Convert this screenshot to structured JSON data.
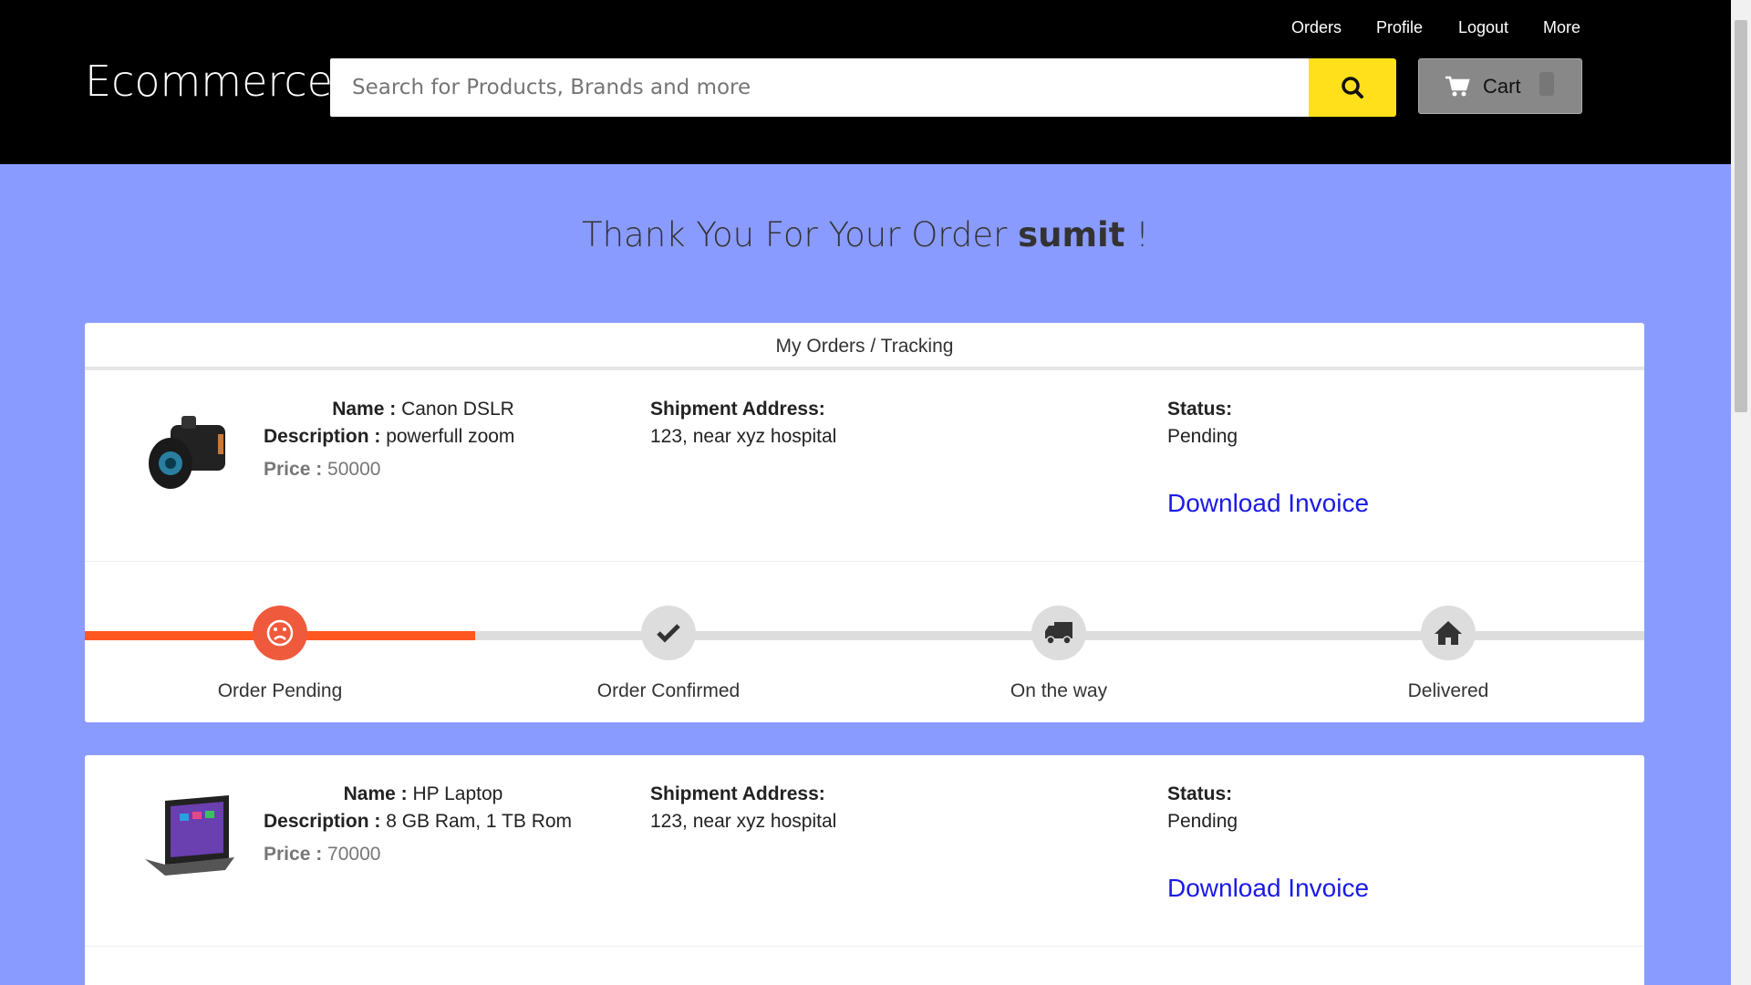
{
  "header": {
    "logo": "Ecommerce",
    "nav": [
      "Orders",
      "Profile",
      "Logout",
      "More"
    ],
    "search_placeholder": "Search for Products, Brands and more",
    "cart_label": "Cart"
  },
  "thanks": {
    "prefix": "Thank You For Your Order",
    "user": "sumit",
    "suffix": "!"
  },
  "orders_title": "My Orders / Tracking",
  "labels": {
    "name": "Name :",
    "description": "Description :",
    "price": "Price :",
    "address": "Shipment Address:",
    "status": "Status:",
    "download": "Download Invoice"
  },
  "orders": [
    {
      "name": "Canon DSLR",
      "description": "powerfull zoom",
      "price": "50000",
      "address": "123, near xyz hospital",
      "status": "Pending",
      "progress_percent": 25
    },
    {
      "name": "HP Laptop",
      "description": "8 GB Ram, 1 TB Rom",
      "price": "70000",
      "address": "123, near xyz hospital",
      "status": "Pending"
    }
  ],
  "steps": [
    "Order Pending",
    "Order Confirmed",
    "On the way",
    "Delivered"
  ],
  "colors": {
    "accent": "#ff5722",
    "search_button": "#ffe01b",
    "background": "#8a9bff",
    "link": "#1a1ae6"
  }
}
